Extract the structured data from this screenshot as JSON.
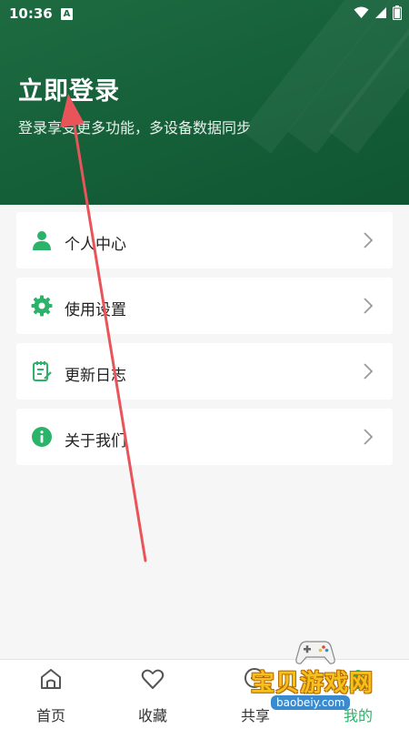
{
  "status_bar": {
    "time": "10:36",
    "app_badge": "A"
  },
  "header": {
    "title": "立即登录",
    "subtitle": "登录享受更多功能，多设备数据同步"
  },
  "menu": {
    "items": [
      {
        "label": "个人中心",
        "icon": "person-icon"
      },
      {
        "label": "使用设置",
        "icon": "gear-icon"
      },
      {
        "label": "更新日志",
        "icon": "notepad-icon"
      },
      {
        "label": "关于我们",
        "icon": "info-icon"
      }
    ]
  },
  "tabbar": {
    "tabs": [
      {
        "label": "首页",
        "icon": "home-icon"
      },
      {
        "label": "收藏",
        "icon": "heart-icon"
      },
      {
        "label": "共享",
        "icon": "share-icon"
      },
      {
        "label": "我的",
        "icon": "profile-icon",
        "active": true
      }
    ]
  },
  "watermark": {
    "text": "宝贝游戏网",
    "domain": "baobeiy.com"
  },
  "colors": {
    "header_bg": "#1e6b41",
    "accent": "#2bb36a",
    "annotation_arrow": "#e9545a",
    "watermark_yellow": "#f4c01c"
  }
}
